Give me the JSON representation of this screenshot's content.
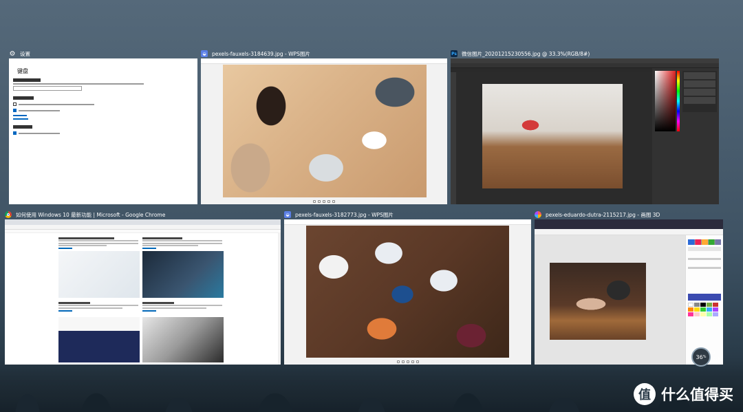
{
  "windows": {
    "settings": {
      "title": "设置",
      "page_title": "键盘",
      "icon": "gear-icon",
      "icon_color": "#5a5a5a"
    },
    "wps_top": {
      "title": "pexels-fauxels-3184639.jpg - WPS图片",
      "icon": "wps-photo-icon",
      "icon_color": "#5b7fe6"
    },
    "photoshop": {
      "title": "微信图片_20201215230556.jpg @ 33.3%(RGB/8#)",
      "icon": "photoshop-icon",
      "icon_letters": "Ps",
      "icon_color": "#0c2a4a"
    },
    "chrome": {
      "title": "如何使用 Windows 10 最新功能 | Microsoft - Google Chrome",
      "icon": "chrome-icon"
    },
    "wps_bottom": {
      "title": "pexels-fauxels-3182773.jpg - WPS图片",
      "icon": "wps-photo-icon",
      "icon_color": "#5b7fe6"
    },
    "paint3d": {
      "title": "pexels-eduardo-dutra-2115217.jpg - 画图 3D",
      "icon": "paint3d-icon"
    }
  },
  "indicator": {
    "value": "36",
    "unit": "%",
    "line1": "1",
    "line2": "0.9"
  },
  "watermark": {
    "glyph": "值",
    "text": "什么值得买"
  },
  "colors": {
    "accent": "#0067c0",
    "desktop_top": "#55697a",
    "desktop_bottom": "#1f2d38"
  }
}
